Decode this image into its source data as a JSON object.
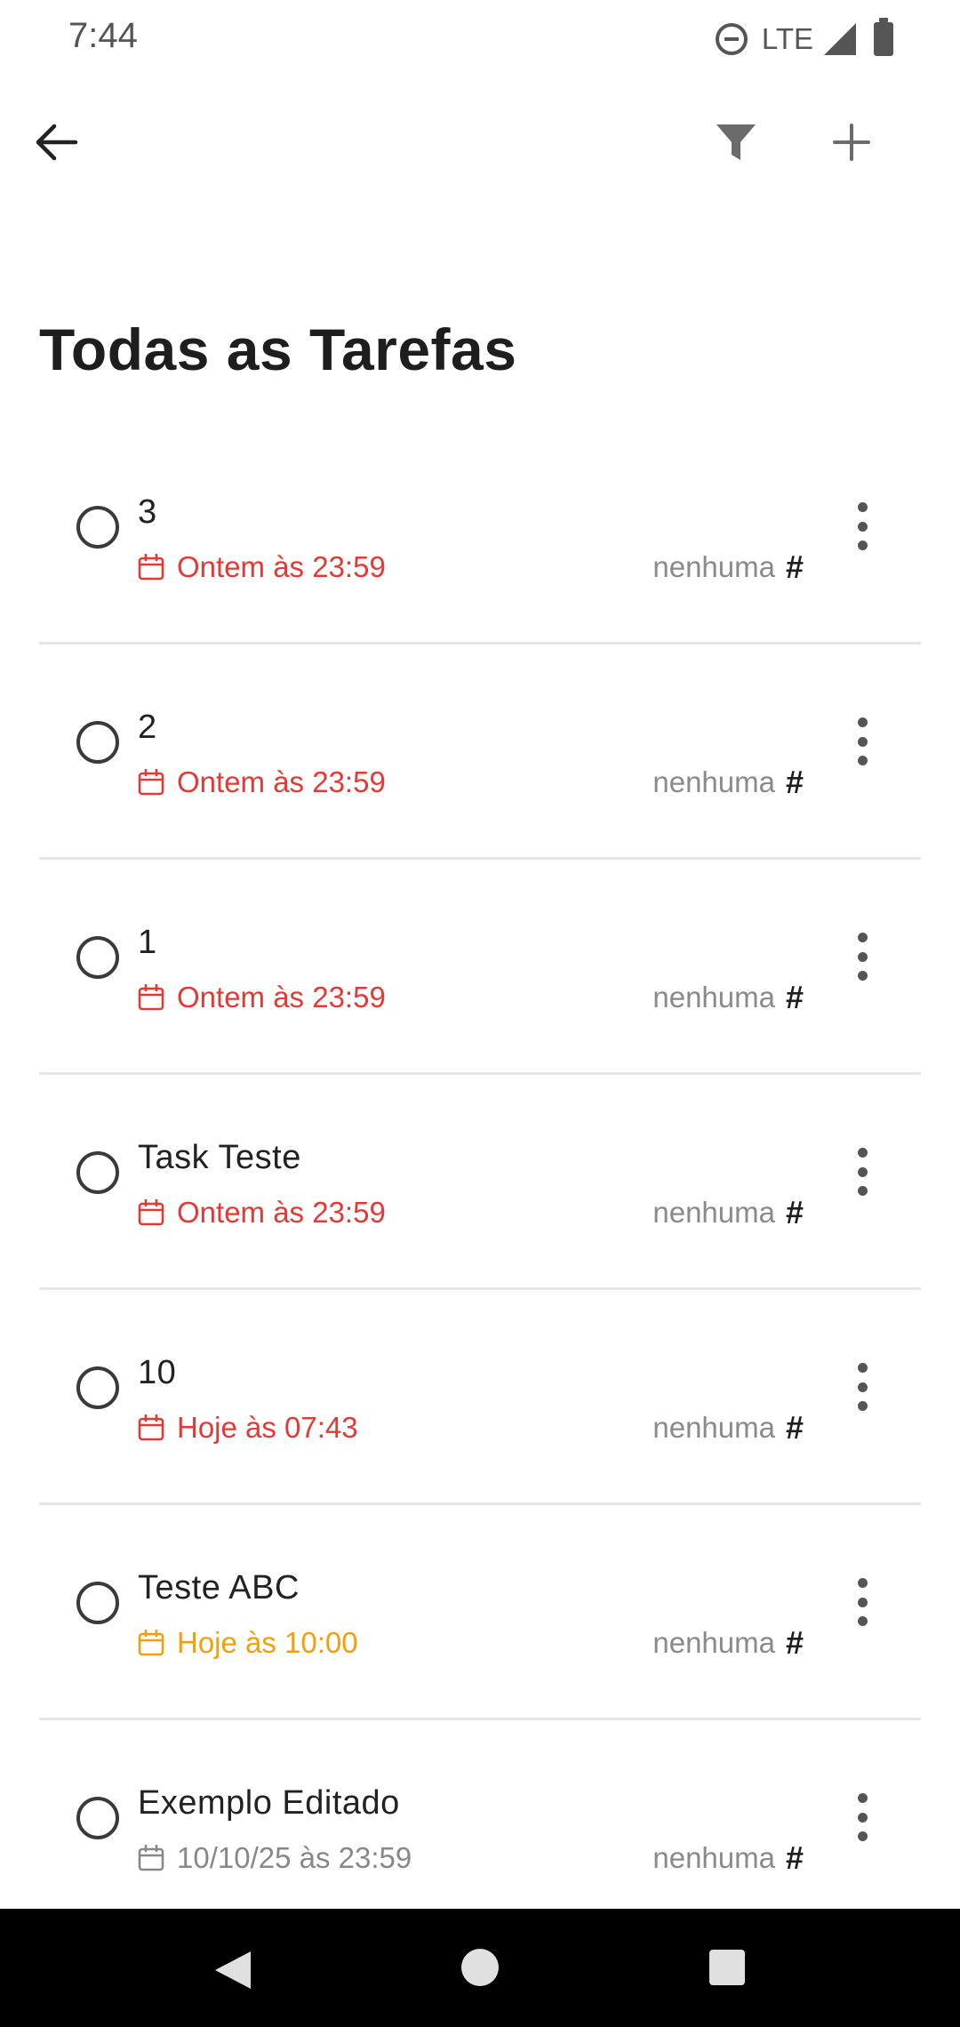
{
  "status_bar": {
    "time": "7:44",
    "network": "LTE",
    "icons": [
      "do-not-disturb-icon",
      "signal-icon",
      "battery-icon"
    ]
  },
  "toolbar": {
    "back_icon": "arrow-left-icon",
    "filter_icon": "filter-icon",
    "add_icon": "plus-icon"
  },
  "page": {
    "title": "Todas as Tarefas"
  },
  "colors": {
    "overdue": "#e53935",
    "today_upcoming": "#f59e0b",
    "future": "#888888",
    "tag_text": "#8a8a8a"
  },
  "tasks": [
    {
      "title": "3",
      "due": "Ontem às 23:59",
      "due_status": "overdue",
      "due_color": "#e53935",
      "tag": "nenhuma"
    },
    {
      "title": "2",
      "due": "Ontem às 23:59",
      "due_status": "overdue",
      "due_color": "#e53935",
      "tag": "nenhuma"
    },
    {
      "title": "1",
      "due": "Ontem às 23:59",
      "due_status": "overdue",
      "due_color": "#e53935",
      "tag": "nenhuma"
    },
    {
      "title": "Task Teste",
      "due": "Ontem às 23:59",
      "due_status": "overdue",
      "due_color": "#e53935",
      "tag": "nenhuma"
    },
    {
      "title": "10",
      "due": "Hoje às 07:43",
      "due_status": "overdue",
      "due_color": "#e53935",
      "tag": "nenhuma"
    },
    {
      "title": "Teste ABC",
      "due": "Hoje às 10:00",
      "due_status": "upcoming",
      "due_color": "#f59e0b",
      "tag": "nenhuma"
    },
    {
      "title": "Exemplo Editado",
      "due": "10/10/25 às 23:59",
      "due_status": "future",
      "due_color": "#888888",
      "tag": "nenhuma"
    }
  ],
  "nav_bar": {
    "icons": [
      "nav-back-icon",
      "nav-home-icon",
      "nav-recents-icon"
    ]
  }
}
